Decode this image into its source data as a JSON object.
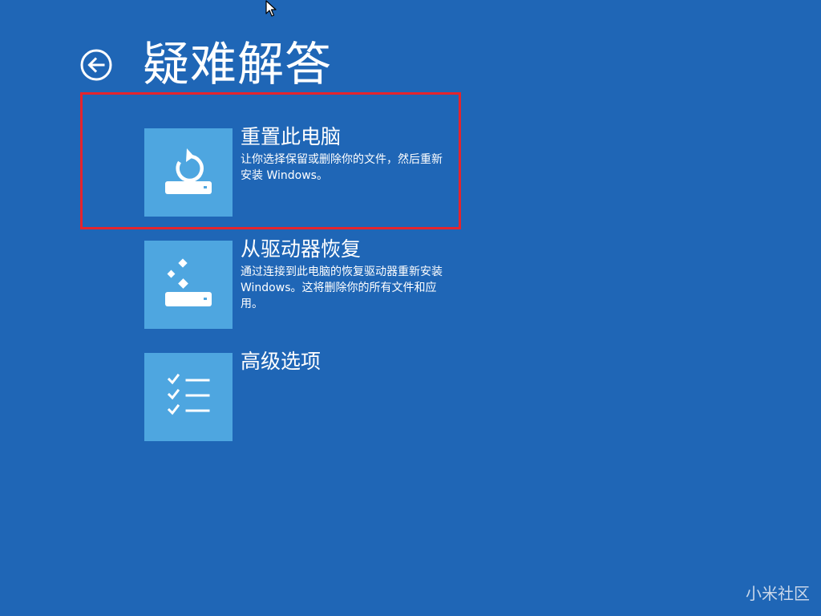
{
  "page": {
    "title": "疑难解答",
    "background_color": "#1f66b6",
    "highlight_color": "#e5242d"
  },
  "back": {
    "icon": "back-arrow-icon"
  },
  "options": [
    {
      "id": "reset",
      "icon": "reset-pc-icon",
      "title": "重置此电脑",
      "description": "让你选择保留或删除你的文件，然后重新安装 Windows。",
      "highlighted": true
    },
    {
      "id": "recover",
      "icon": "recover-from-drive-icon",
      "title": "从驱动器恢复",
      "description": "通过连接到此电脑的恢复驱动器重新安装 Windows。这将删除你的所有文件和应用。",
      "highlighted": false
    },
    {
      "id": "advanced",
      "icon": "checklist-icon",
      "title": "高级选项",
      "description": "",
      "highlighted": false
    }
  ],
  "tile_color": "#4ea6e0",
  "watermark": "小米社区"
}
